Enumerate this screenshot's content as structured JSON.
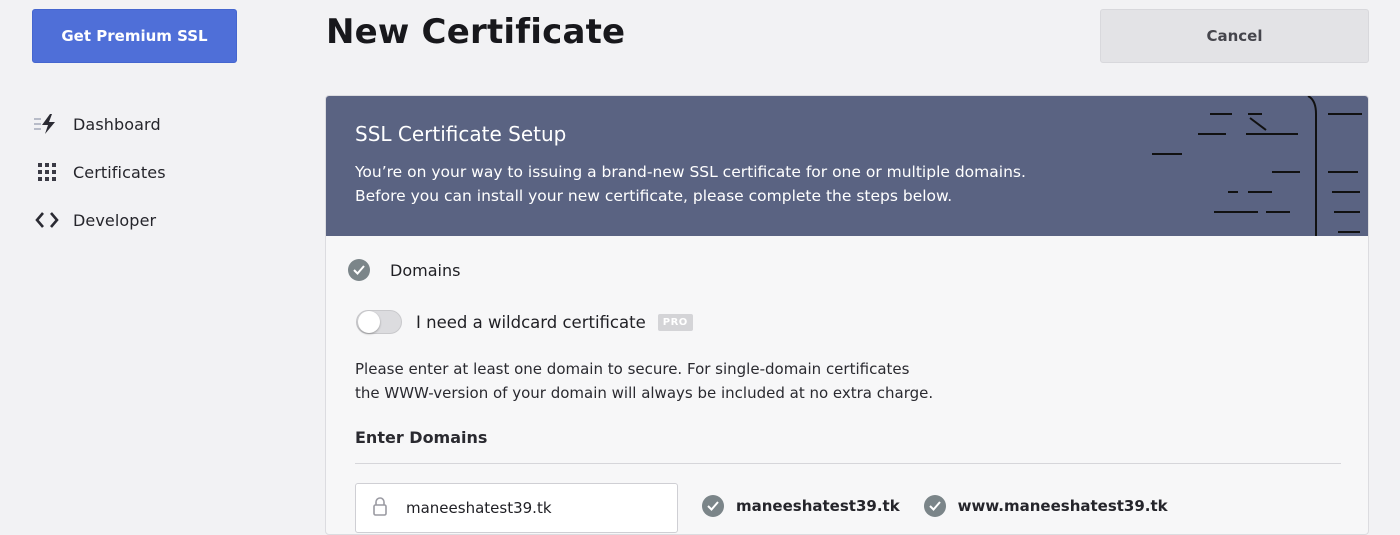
{
  "sidebar": {
    "premium_button": "Get Premium SSL",
    "items": [
      {
        "label": "Dashboard",
        "icon": "lightning-icon"
      },
      {
        "label": "Certificates",
        "icon": "grid-icon"
      },
      {
        "label": "Developer",
        "icon": "code-icon"
      }
    ]
  },
  "header": {
    "title": "New Certificate",
    "cancel_label": "Cancel"
  },
  "banner": {
    "title": "SSL Certificate Setup",
    "line1": "You’re on your way to issuing a brand-new SSL certificate for one or multiple domains.",
    "line2": "Before you can install your new certificate, please complete the steps below."
  },
  "step": {
    "label": "Domains",
    "status_icon": "check-circle-icon"
  },
  "wildcard": {
    "label": "I need a wildcard certificate",
    "badge": "PRO",
    "enabled": false
  },
  "help": {
    "line1": "Please enter at least one domain to secure. For single-domain certificates",
    "line2": "the WWW-version of your domain will always be included at no extra charge."
  },
  "domains": {
    "section_label": "Enter Domains",
    "input_value": "maneeshatest39.tk",
    "list": [
      "maneeshatest39.tk",
      "www.maneeshatest39.tk"
    ]
  },
  "colors": {
    "primary": "#4f6fd8",
    "banner": "#5a6382",
    "check": "#7b8589"
  }
}
